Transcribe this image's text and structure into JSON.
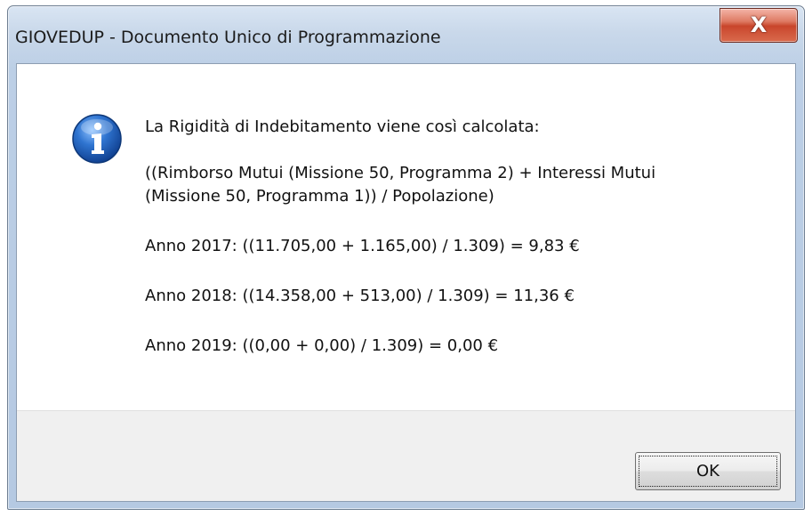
{
  "window": {
    "title": "GIOVEDUP - Documento Unico di Programmazione",
    "close_glyph": "X"
  },
  "dialog": {
    "icon": "info-icon",
    "lines": [
      "La Rigidità di Indebitamento viene così calcolata:",
      "((Rimborso Mutui (Missione 50, Programma 2) + Interessi Mutui",
      "(Missione 50, Programma 1)) / Popolazione)",
      "Anno 2017: ((11.705,00 + 1.165,00) / 1.309)  = 9,83 €",
      "Anno 2018: ((14.358,00 + 513,00) / 1.309)  = 11,36 €",
      "Anno 2019: ((0,00 + 0,00) / 1.309)  = 0,00 €"
    ],
    "ok_label": "OK"
  },
  "colors": {
    "close_button": "#c9462c",
    "info_icon": "#2b6cc4"
  }
}
